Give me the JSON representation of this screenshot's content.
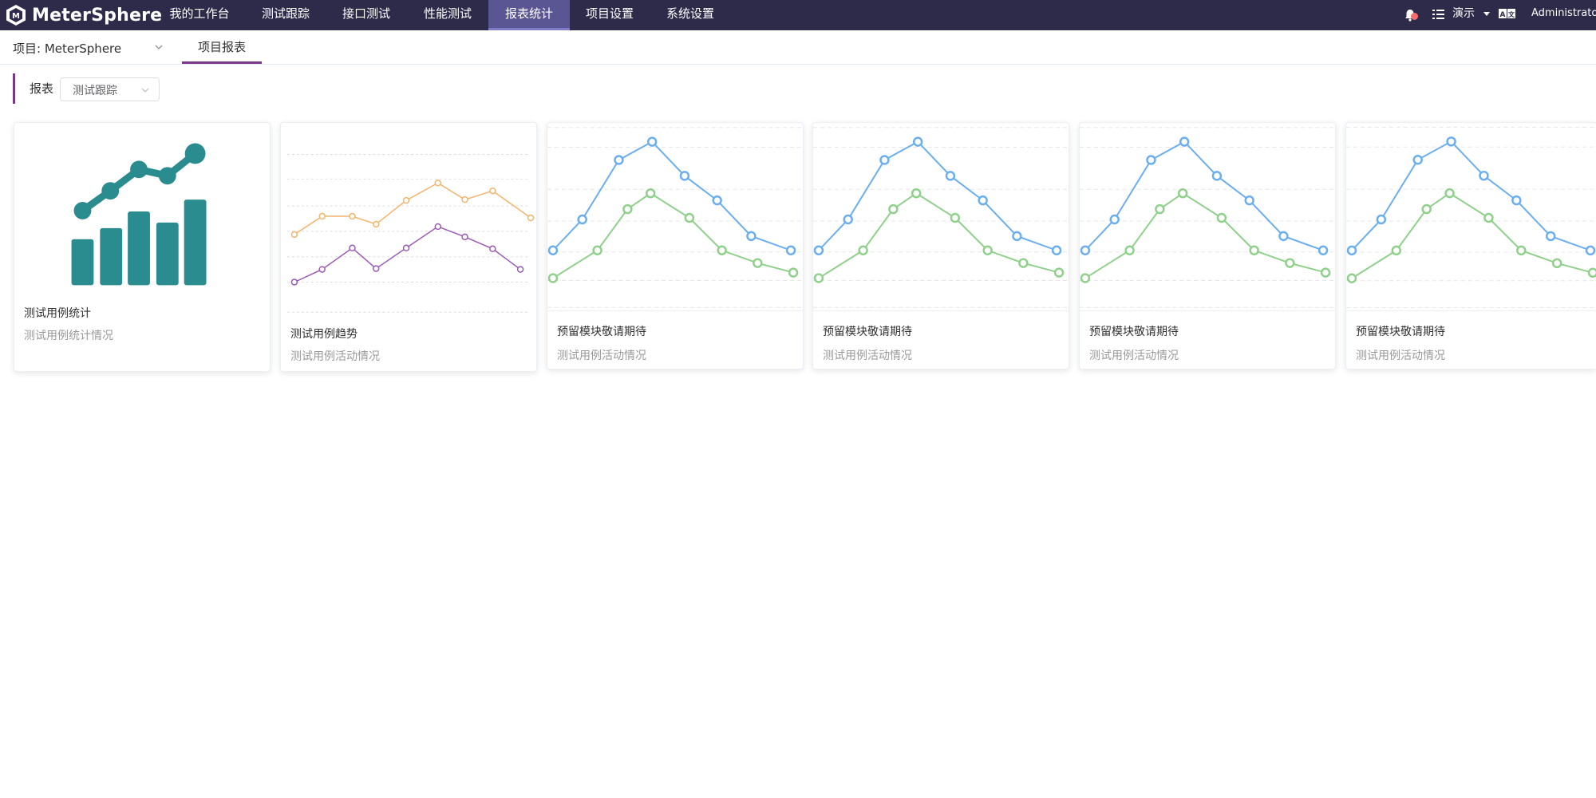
{
  "app": {
    "name": "MeterSphere"
  },
  "nav": {
    "items": [
      {
        "label": "我的工作台"
      },
      {
        "label": "测试跟踪"
      },
      {
        "label": "接口测试"
      },
      {
        "label": "性能测试"
      },
      {
        "label": "报表统计",
        "active": true
      },
      {
        "label": "项目设置"
      },
      {
        "label": "系统设置"
      }
    ]
  },
  "header_right": {
    "icons": [
      "bell-icon",
      "list-icon",
      "language-icon"
    ],
    "workspace": "演示",
    "user": "Administrator"
  },
  "subheader": {
    "project": "项目: MeterSphere",
    "tab": "项目报表"
  },
  "filter": {
    "label": "报表",
    "value": "测试跟踪"
  },
  "cards": [
    {
      "title": "测试用例统计",
      "desc": "测试用例统计情况",
      "thumb": "bar-growth-icon"
    },
    {
      "title": "测试用例趋势",
      "desc": "测试用例活动情况",
      "thumb": "line-trend"
    },
    {
      "title": "预留模块敬请期待",
      "desc": "测试用例活动情况",
      "thumb": "line-peak"
    },
    {
      "title": "预留模块敬请期待",
      "desc": "测试用例活动情况",
      "thumb": "line-peak"
    },
    {
      "title": "预留模块敬请期待",
      "desc": "测试用例活动情况",
      "thumb": "line-peak"
    },
    {
      "title": "预留模块敬请期待",
      "desc": "测试用例活动情况",
      "thumb": "line-peak"
    }
  ],
  "colors": {
    "header_bg": "#2d2a4a",
    "nav_active": "#5a5694",
    "accent": "#783887",
    "teal": "#2a8c8e",
    "line_orange": "#f5b46b",
    "line_purple": "#9b59b6",
    "line_blue": "#6aaef0",
    "line_green": "#8fd08a"
  }
}
